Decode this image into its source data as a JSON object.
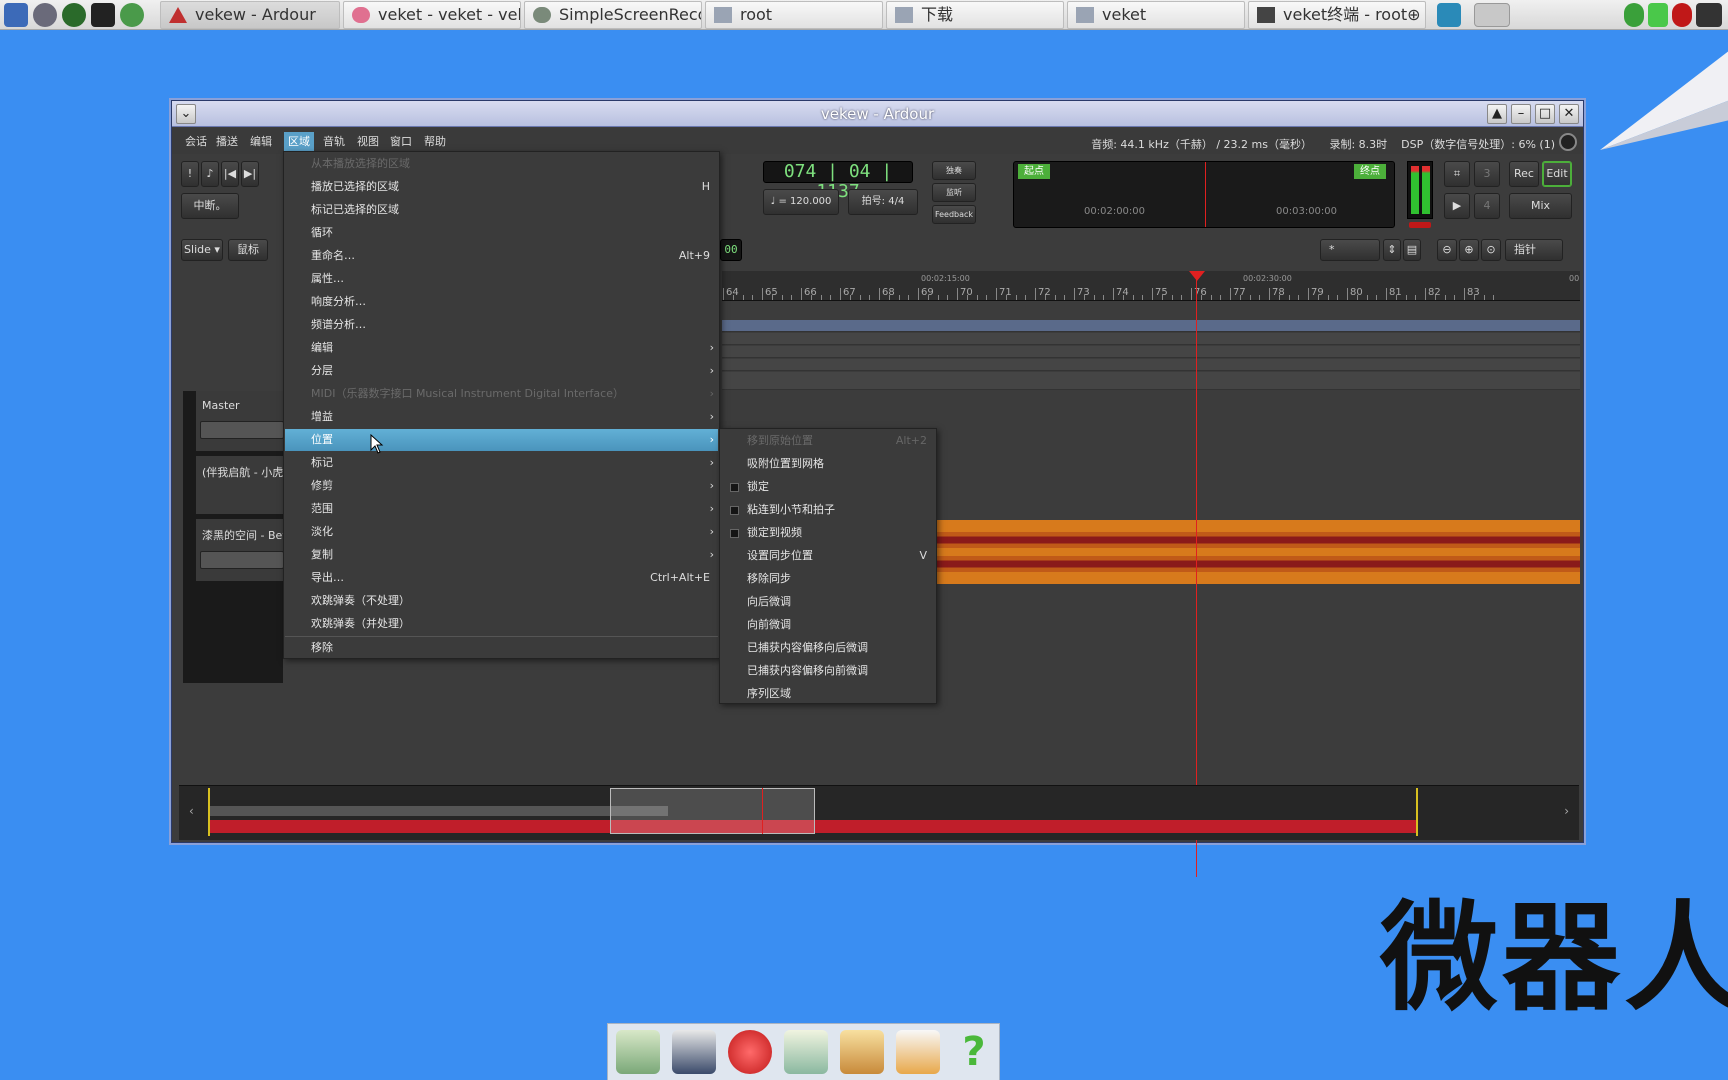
{
  "taskbar": {
    "tasks": [
      {
        "label": "vekew - Ardour"
      },
      {
        "label": "veket - veket - vek…"
      },
      {
        "label": "SimpleScreenReco…"
      },
      {
        "label": "root"
      },
      {
        "label": "下载"
      },
      {
        "label": "veket"
      },
      {
        "label": "veket终端 - root⊕ v…"
      }
    ]
  },
  "window": {
    "title": "vekew - Ardour",
    "menubar": [
      "会话",
      "播送",
      "编辑",
      "区域",
      "音轨",
      "视图",
      "窗口",
      "帮助"
    ],
    "status": {
      "audio": "音频: 44.1 kHz（千赫） / 23.2 ms（毫秒）",
      "rec": "录制: 8.3时",
      "dsp": "DSP（数字信号处理）:  6% (1)"
    }
  },
  "transport": {
    "clock_bbt": "074 | 04 | 1137",
    "tempo": "♩ = 120.000",
    "meter": "拍号:  4/4",
    "partial_clock": "00",
    "buttons": {
      "solo": "独奏",
      "monitor": "监听",
      "feedback": "Feedback",
      "stop": "中断。"
    },
    "mini_timeline": {
      "start_marker": "起点",
      "end_marker": "终点",
      "t1": "00:02:00:00",
      "t2": "00:03:00:00"
    },
    "mode_buttons": {
      "rec": "Rec",
      "edit": "Edit",
      "mix": "Mix",
      "num3": "3",
      "num4": "4"
    }
  },
  "edit_toolbar": {
    "edit_mode": "Slide",
    "ripple_mode": "鼠标",
    "snap_value": "*",
    "pointer": "指针"
  },
  "ruler": {
    "timecode_labels": [
      "00:02:15:00",
      "00:02:30:00",
      "00"
    ],
    "bars": [
      "64",
      "65",
      "66",
      "67",
      "68",
      "69",
      "70",
      "71",
      "72",
      "73",
      "74",
      "75",
      "76",
      "77",
      "78",
      "79",
      "80",
      "81",
      "82",
      "83"
    ]
  },
  "tracks": [
    {
      "name": "Master"
    },
    {
      "name": "(伴我启航 - 小虎"
    },
    {
      "name": "漆黑的空间 - Bey"
    }
  ],
  "region_menu": {
    "items": [
      {
        "label": "从本播放选择的区域",
        "disabled": true
      },
      {
        "label": "播放已选择的区域",
        "accel": "H"
      },
      {
        "label": "标记已选择的区域"
      },
      {
        "label": "循环"
      },
      {
        "label": "重命名…",
        "accel": "Alt+9"
      },
      {
        "label": "属性…"
      },
      {
        "label": "响度分析…"
      },
      {
        "label": "频谱分析…"
      },
      {
        "label": "编辑",
        "submenu": true
      },
      {
        "label": "分层",
        "submenu": true
      },
      {
        "label": "MIDI（乐器数字接口 Musical Instrument Digital Interface）",
        "disabled": true,
        "submenu": true
      },
      {
        "label": "增益",
        "submenu": true
      },
      {
        "label": "位置",
        "submenu": true,
        "highlighted": true
      },
      {
        "label": "标记",
        "submenu": true
      },
      {
        "label": "修剪",
        "submenu": true
      },
      {
        "label": "范围",
        "submenu": true
      },
      {
        "label": "淡化",
        "submenu": true
      },
      {
        "label": "复制",
        "submenu": true
      },
      {
        "label": "导出…",
        "accel": "Ctrl+Alt+E"
      },
      {
        "label": "欢跳弹奏（不处理）"
      },
      {
        "label": "欢跳弹奏（并处理）"
      },
      {
        "label": "移除"
      }
    ]
  },
  "position_submenu": {
    "items": [
      {
        "label": "移到原始位置",
        "accel": "Alt+2",
        "disabled": true
      },
      {
        "label": "吸附位置到网格"
      },
      {
        "label": "锁定",
        "check": true
      },
      {
        "label": "粘连到小节和拍子",
        "check": true
      },
      {
        "label": "锁定到视频",
        "check": true
      },
      {
        "label": "设置同步位置",
        "accel": "V"
      },
      {
        "label": "移除同步"
      },
      {
        "label": "向后微调"
      },
      {
        "label": "向前微调"
      },
      {
        "label": "已捕获内容偏移向后微调"
      },
      {
        "label": "已捕获内容偏移向前微调"
      },
      {
        "label": "序列区域"
      }
    ]
  },
  "desktop": {
    "watermark": "微器人"
  },
  "colors": {
    "desktop": "#3a8ef2",
    "menu_highlight": "#5aa6cf",
    "region": "#d77a1c",
    "playhead": "#e02020",
    "clock_green": "#7ee07e"
  }
}
